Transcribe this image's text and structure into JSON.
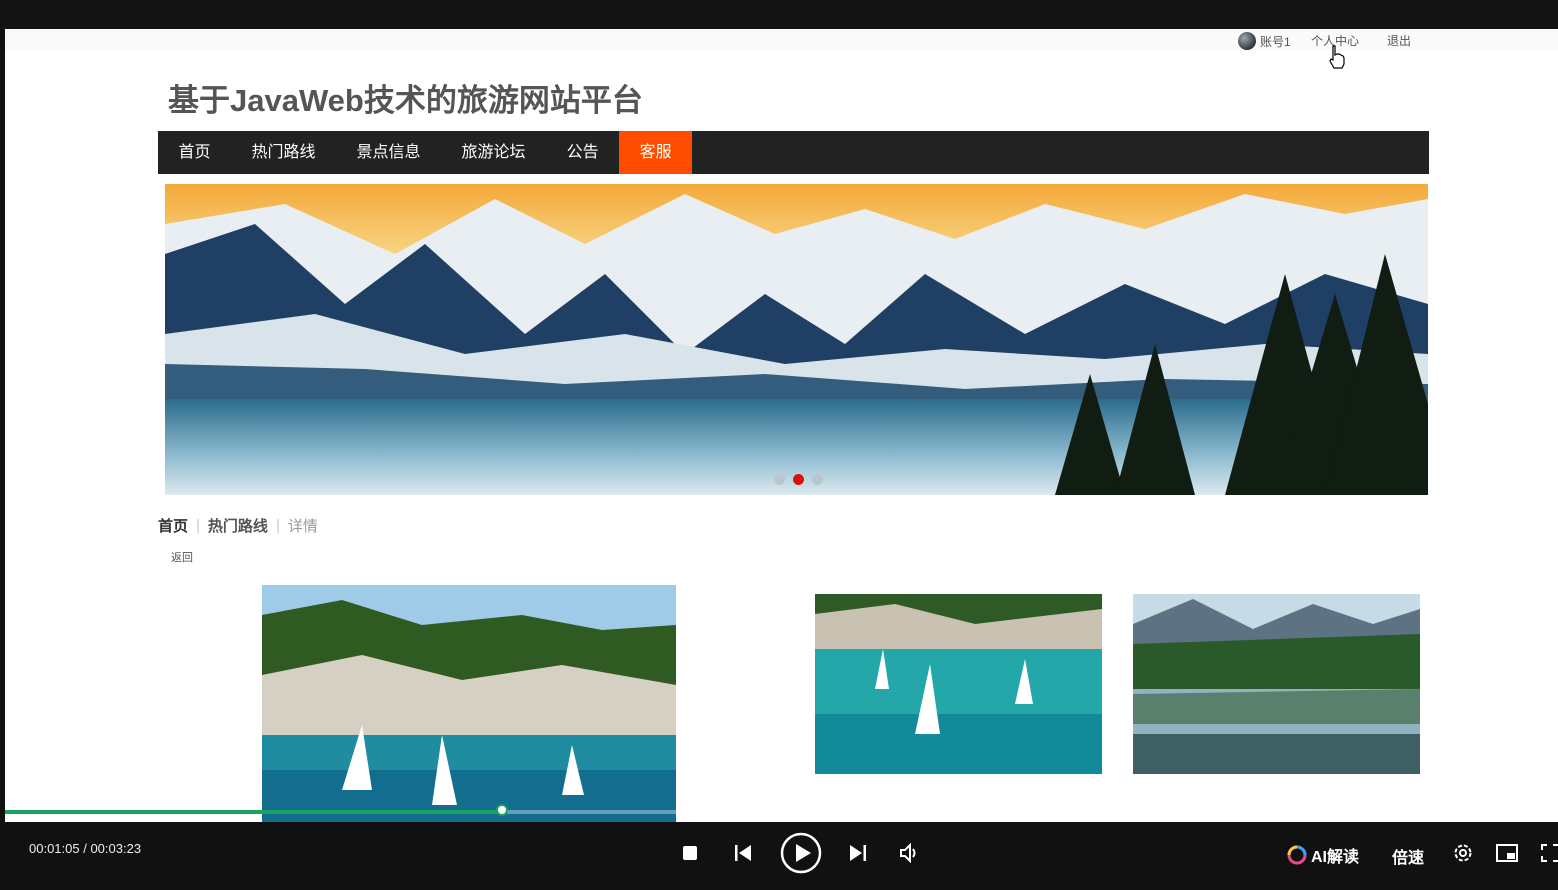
{
  "user": {
    "name": "账号1",
    "center": "个人中心",
    "logout": "退出"
  },
  "site": {
    "title": "基于JavaWeb技术的旅游网站平台"
  },
  "nav": {
    "items": [
      "首页",
      "热门路线",
      "景点信息",
      "旅游论坛",
      "公告",
      "客服"
    ],
    "active_index": 5
  },
  "banner": {
    "dots": 3,
    "active_dot": 1
  },
  "breadcrumb": {
    "home": "首页",
    "section": "热门路线",
    "current": "详情"
  },
  "back_label": "返回",
  "player": {
    "time": "00:01:05 / 00:03:23",
    "progress_fraction": 0.32,
    "ai_label": "AI解读",
    "speed_label": "倍速"
  },
  "colors": {
    "accent": "#ff4d00",
    "nav_bg": "#222222",
    "progress": "#1aa260",
    "dot_active": "#d2160f"
  },
  "icons": [
    "stop-icon",
    "previous-icon",
    "play-icon",
    "next-icon",
    "volume-icon",
    "ai-icon",
    "settings-icon",
    "picture-in-picture-icon",
    "fullscreen-icon",
    "hand-cursor-icon"
  ]
}
